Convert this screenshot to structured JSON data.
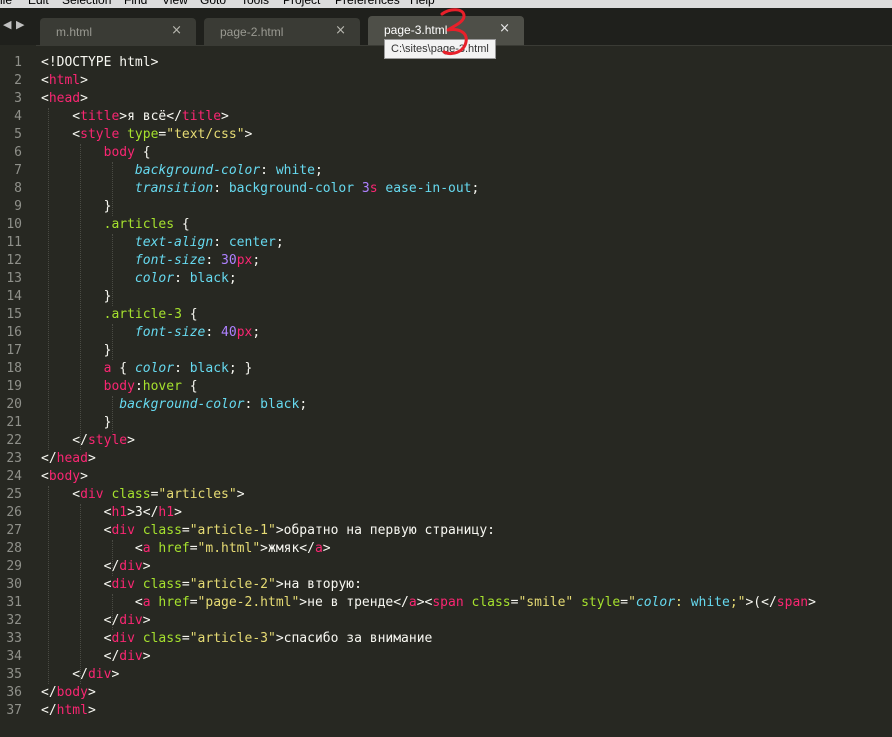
{
  "menu": [
    "ile",
    "Edit",
    "Selection",
    "Find",
    "View",
    "Goto",
    "Tools",
    "Project",
    "Preferences",
    "Help"
  ],
  "tabs": [
    {
      "label": "m.html",
      "close": "×"
    },
    {
      "label": "page-2.html",
      "close": "×"
    },
    {
      "label": "page-3.html",
      "close": "×"
    }
  ],
  "tooltip": "C:\\sites\\page-3.html",
  "annotation_color": "#e8202a",
  "line_numbers": [
    "1",
    "2",
    "3",
    "4",
    "5",
    "6",
    "7",
    "8",
    "9",
    "10",
    "11",
    "12",
    "13",
    "14",
    "15",
    "16",
    "17",
    "18",
    "19",
    "20",
    "21",
    "22",
    "23",
    "24",
    "25",
    "26",
    "27",
    "28",
    "29",
    "30",
    "31",
    "32",
    "33",
    "34",
    "35",
    "36",
    "37"
  ],
  "code_lines": [
    [
      [
        "",
        "<!DOCTYPE html>"
      ]
    ],
    [
      [
        "",
        "<"
      ],
      [
        "t-tag",
        "html"
      ],
      [
        "",
        ">"
      ]
    ],
    [
      [
        "",
        "<"
      ],
      [
        "t-tag",
        "head"
      ],
      [
        "",
        ">"
      ]
    ],
    [
      [
        "",
        "    <"
      ],
      [
        "t-tag",
        "title"
      ],
      [
        "",
        ">я всё</"
      ],
      [
        "t-tag",
        "title"
      ],
      [
        "",
        ">"
      ]
    ],
    [
      [
        "",
        "    <"
      ],
      [
        "t-tag",
        "style"
      ],
      [
        "",
        " "
      ],
      [
        "t-attr",
        "type"
      ],
      [
        "",
        "="
      ],
      [
        "t-str",
        "\"text/css\""
      ],
      [
        "",
        ">"
      ]
    ],
    [
      [
        "",
        "        "
      ],
      [
        "t-tag",
        "body"
      ],
      [
        "",
        " {"
      ]
    ],
    [
      [
        "",
        "            "
      ],
      [
        "t-prop",
        "background-color"
      ],
      [
        "",
        ": "
      ],
      [
        "t-val",
        "white"
      ],
      [
        "",
        ";"
      ]
    ],
    [
      [
        "",
        "            "
      ],
      [
        "t-prop",
        "transition"
      ],
      [
        "",
        ": "
      ],
      [
        "t-val",
        "background-color"
      ],
      [
        "",
        " "
      ],
      [
        "t-num",
        "3"
      ],
      [
        "t-tag",
        "s"
      ],
      [
        "",
        " "
      ],
      [
        "t-val",
        "ease-in-out"
      ],
      [
        "",
        ";"
      ]
    ],
    [
      [
        "",
        "        }"
      ]
    ],
    [
      [
        "",
        "        "
      ],
      [
        "t-sel",
        ".articles"
      ],
      [
        "",
        " {"
      ]
    ],
    [
      [
        "",
        "            "
      ],
      [
        "t-prop",
        "text-align"
      ],
      [
        "",
        ": "
      ],
      [
        "t-val",
        "center"
      ],
      [
        "",
        ";"
      ]
    ],
    [
      [
        "",
        "            "
      ],
      [
        "t-prop",
        "font-size"
      ],
      [
        "",
        ": "
      ],
      [
        "t-num",
        "30"
      ],
      [
        "t-tag",
        "px"
      ],
      [
        "",
        ";"
      ]
    ],
    [
      [
        "",
        "            "
      ],
      [
        "t-prop",
        "color"
      ],
      [
        "",
        ": "
      ],
      [
        "t-val",
        "black"
      ],
      [
        "",
        ";"
      ]
    ],
    [
      [
        "",
        "        }"
      ]
    ],
    [
      [
        "",
        "        "
      ],
      [
        "t-sel",
        ".article-3"
      ],
      [
        "",
        " {"
      ]
    ],
    [
      [
        "",
        "            "
      ],
      [
        "t-prop",
        "font-size"
      ],
      [
        "",
        ": "
      ],
      [
        "t-num",
        "40"
      ],
      [
        "t-tag",
        "px"
      ],
      [
        "",
        ";"
      ]
    ],
    [
      [
        "",
        "        }"
      ]
    ],
    [
      [
        "",
        "        "
      ],
      [
        "t-tag",
        "a"
      ],
      [
        "",
        " { "
      ],
      [
        "t-prop",
        "color"
      ],
      [
        "",
        ": "
      ],
      [
        "t-val",
        "black"
      ],
      [
        "",
        "; }"
      ]
    ],
    [
      [
        "",
        "        "
      ],
      [
        "t-tag",
        "body"
      ],
      [
        "",
        ":"
      ],
      [
        "t-sel",
        "hover"
      ],
      [
        "",
        " {"
      ]
    ],
    [
      [
        "",
        "          "
      ],
      [
        "t-prop",
        "background-color"
      ],
      [
        "",
        ": "
      ],
      [
        "t-val",
        "black"
      ],
      [
        "",
        ";"
      ]
    ],
    [
      [
        "",
        "        }"
      ]
    ],
    [
      [
        "",
        "    </"
      ],
      [
        "t-tag",
        "style"
      ],
      [
        "",
        ">"
      ]
    ],
    [
      [
        "",
        "</"
      ],
      [
        "t-tag",
        "head"
      ],
      [
        "",
        ">"
      ]
    ],
    [
      [
        "",
        "<"
      ],
      [
        "t-tag",
        "body"
      ],
      [
        "",
        ">"
      ]
    ],
    [
      [
        "",
        "    <"
      ],
      [
        "t-tag",
        "div"
      ],
      [
        "",
        " "
      ],
      [
        "t-attr",
        "class"
      ],
      [
        "",
        "="
      ],
      [
        "t-str",
        "\"articles\""
      ],
      [
        "",
        ">"
      ]
    ],
    [
      [
        "",
        "        <"
      ],
      [
        "t-tag",
        "h1"
      ],
      [
        "",
        ">3</"
      ],
      [
        "t-tag",
        "h1"
      ],
      [
        "",
        ">"
      ]
    ],
    [
      [
        "",
        "        <"
      ],
      [
        "t-tag",
        "div"
      ],
      [
        "",
        " "
      ],
      [
        "t-attr",
        "class"
      ],
      [
        "",
        "="
      ],
      [
        "t-str",
        "\"article-1\""
      ],
      [
        "",
        ">обратно на первую страницу:"
      ]
    ],
    [
      [
        "",
        "            <"
      ],
      [
        "t-tag",
        "a"
      ],
      [
        "",
        " "
      ],
      [
        "t-attr",
        "href"
      ],
      [
        "",
        "="
      ],
      [
        "t-str",
        "\"m.html\""
      ],
      [
        "",
        ">жмяк</"
      ],
      [
        "t-tag",
        "a"
      ],
      [
        "",
        ">"
      ]
    ],
    [
      [
        "",
        "        </"
      ],
      [
        "t-tag",
        "div"
      ],
      [
        "",
        ">"
      ]
    ],
    [
      [
        "",
        "        <"
      ],
      [
        "t-tag",
        "div"
      ],
      [
        "",
        " "
      ],
      [
        "t-attr",
        "class"
      ],
      [
        "",
        "="
      ],
      [
        "t-str",
        "\"article-2\""
      ],
      [
        "",
        ">на вторую:"
      ]
    ],
    [
      [
        "",
        "            <"
      ],
      [
        "t-tag",
        "a"
      ],
      [
        "",
        " "
      ],
      [
        "t-attr",
        "href"
      ],
      [
        "",
        "="
      ],
      [
        "t-str",
        "\"page-2.html\""
      ],
      [
        "",
        ">не в тренде</"
      ],
      [
        "t-tag",
        "a"
      ],
      [
        "",
        "><"
      ],
      [
        "t-tag",
        "span"
      ],
      [
        "",
        " "
      ],
      [
        "t-attr",
        "class"
      ],
      [
        "",
        "="
      ],
      [
        "t-str",
        "\"smile\""
      ],
      [
        "",
        " "
      ],
      [
        "t-attr",
        "style"
      ],
      [
        "",
        "="
      ],
      [
        "t-str",
        "\""
      ],
      [
        "t-prop",
        "color"
      ],
      [
        "t-str",
        ": "
      ],
      [
        "t-val",
        "white"
      ],
      [
        "t-str",
        ";\""
      ],
      [
        "",
        ">(</"
      ],
      [
        "t-tag",
        "span"
      ],
      [
        "",
        ">"
      ]
    ],
    [
      [
        "",
        "        </"
      ],
      [
        "t-tag",
        "div"
      ],
      [
        "",
        ">"
      ]
    ],
    [
      [
        "",
        "        <"
      ],
      [
        "t-tag",
        "div"
      ],
      [
        "",
        " "
      ],
      [
        "t-attr",
        "class"
      ],
      [
        "",
        "="
      ],
      [
        "t-str",
        "\"article-3\""
      ],
      [
        "",
        ">спасибо за внимание"
      ]
    ],
    [
      [
        "",
        "        </"
      ],
      [
        "t-tag",
        "div"
      ],
      [
        "",
        ">"
      ]
    ],
    [
      [
        "",
        "    </"
      ],
      [
        "t-tag",
        "div"
      ],
      [
        "",
        ">"
      ]
    ],
    [
      [
        "",
        "</"
      ],
      [
        "t-tag",
        "body"
      ],
      [
        "",
        ">"
      ]
    ],
    [
      [
        "",
        "</"
      ],
      [
        "t-tag",
        "html"
      ],
      [
        "",
        ">"
      ]
    ]
  ]
}
